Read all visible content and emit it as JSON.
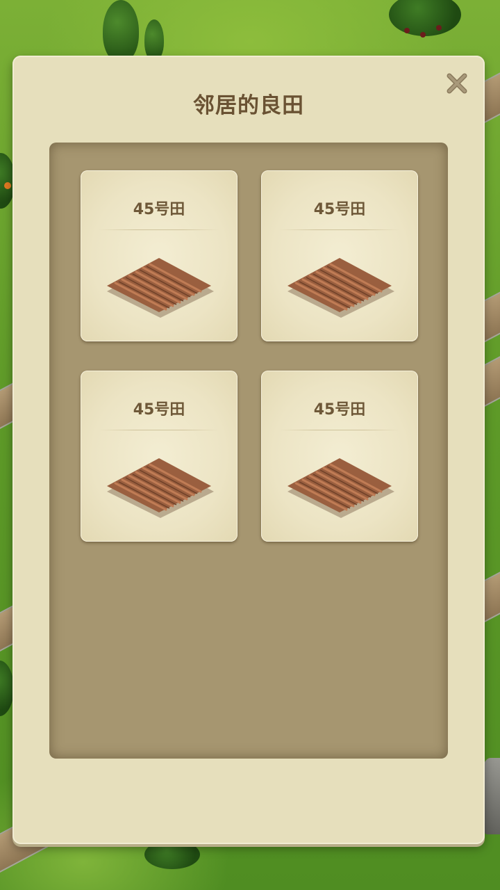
{
  "dialog": {
    "title": "邻居的良田",
    "close_icon": "close-x-icon",
    "fields": [
      {
        "label": "45号田",
        "icon": "farmland-plot-icon"
      },
      {
        "label": "45号田",
        "icon": "farmland-plot-icon"
      },
      {
        "label": "45号田",
        "icon": "farmland-plot-icon"
      },
      {
        "label": "45号田",
        "icon": "farmland-plot-icon"
      }
    ]
  },
  "colors": {
    "panel_bg": "#e6dfbc",
    "inner_panel": "#a69670",
    "title_text": "#6a5233",
    "soil": "#9a5f3f"
  }
}
